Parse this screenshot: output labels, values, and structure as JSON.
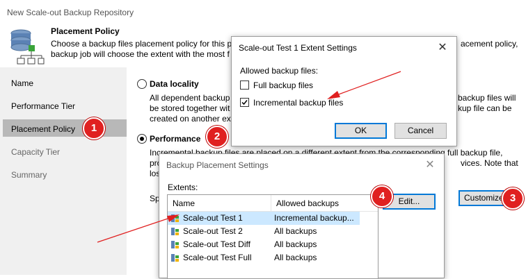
{
  "main_window": {
    "title": "New Scale-out Backup Repository",
    "header_title": "Placement Policy",
    "header_desc_line1": "Choose a backup files placement policy for this p",
    "header_desc_line2": "backup job will choose the extent with the most f",
    "header_desc_right1": "acement policy,",
    "nav": [
      "Name",
      "Performance Tier",
      "Placement Policy",
      "Capacity Tier",
      "Summary"
    ],
    "data_locality_label": "Data locality",
    "data_locality_desc": [
      "All dependent backup",
      "be stored together wit",
      "created on another ext"
    ],
    "data_locality_desc_right": [
      "backup files will",
      "kup file can be"
    ],
    "performance_label": "Performance",
    "performance_desc": [
      "Incremental backup files are placed on a different extent from the corresponding full backup file,",
      "pro",
      "los"
    ],
    "performance_desc_right": "vices. Note that",
    "spec_fragment": "Sp",
    "customize_label": "Customize"
  },
  "extent_dialog": {
    "title": "Scale-out Test 1 Extent Settings",
    "allowed_label": "Allowed backup files:",
    "full_label": "Full backup files",
    "full_checked": false,
    "incremental_label": "Incremental backup files",
    "incremental_checked": true,
    "ok_label": "OK",
    "cancel_label": "Cancel"
  },
  "placement_dialog": {
    "title": "Backup Placement Settings",
    "extents_label": "Extents:",
    "col_name": "Name",
    "col_allowed": "Allowed backups",
    "edit_label": "Edit...",
    "rows": [
      {
        "name": "Scale-out Test 1",
        "allowed": "Incremental backup..."
      },
      {
        "name": "Scale-out Test 2",
        "allowed": "All backups"
      },
      {
        "name": "Scale-out Test Diff",
        "allowed": "All backups"
      },
      {
        "name": "Scale-out Test Full",
        "allowed": "All backups"
      }
    ]
  },
  "badges": [
    "1",
    "2",
    "3",
    "4"
  ],
  "colors": {
    "badge": "#e02020",
    "arrow": "#e02020",
    "selected_row": "#cce8ff",
    "focus_border": "#0078d7",
    "nav_selected": "#b8b8b8"
  }
}
